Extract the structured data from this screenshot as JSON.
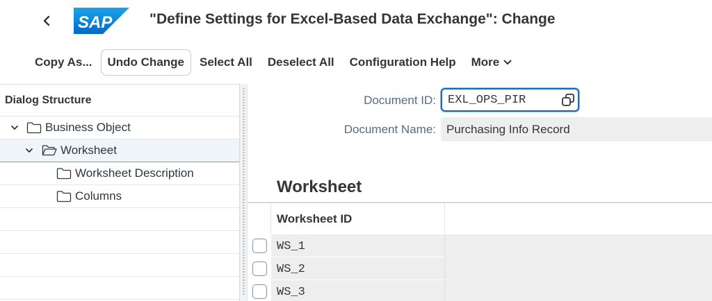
{
  "header": {
    "title": "\"Define Settings for Excel-Based Data Exchange\": Change",
    "logo_text": "SAP",
    "brand_color": "#0a6ed1",
    "back_icon": "chevron-left-icon"
  },
  "toolbar": {
    "buttons": [
      {
        "label": "Copy As..."
      },
      {
        "label": "Undo Change"
      },
      {
        "label": "Select All"
      },
      {
        "label": "Deselect All"
      },
      {
        "label": "Configuration Help"
      },
      {
        "label": "More"
      }
    ]
  },
  "dialog_structure": {
    "heading": "Dialog Structure",
    "items": [
      {
        "label": "Business Object",
        "expanded": true,
        "icon": "folder-icon"
      },
      {
        "label": "Worksheet",
        "expanded": true,
        "selected": true,
        "icon": "folder-open-icon"
      },
      {
        "label": "Worksheet Description",
        "icon": "folder-icon"
      },
      {
        "label": "Columns",
        "icon": "folder-icon"
      }
    ]
  },
  "form": {
    "document_id_label": "Document ID:",
    "document_id_value": "EXL_OPS_PIR",
    "document_name_label": "Document Name:",
    "document_name_value": "Purchasing Info Record"
  },
  "worksheet_table": {
    "title": "Worksheet",
    "column_header": "Worksheet ID",
    "rows": [
      {
        "id": "WS_1",
        "selected": false
      },
      {
        "id": "WS_2",
        "selected": false
      },
      {
        "id": "WS_3",
        "selected": false
      }
    ]
  }
}
